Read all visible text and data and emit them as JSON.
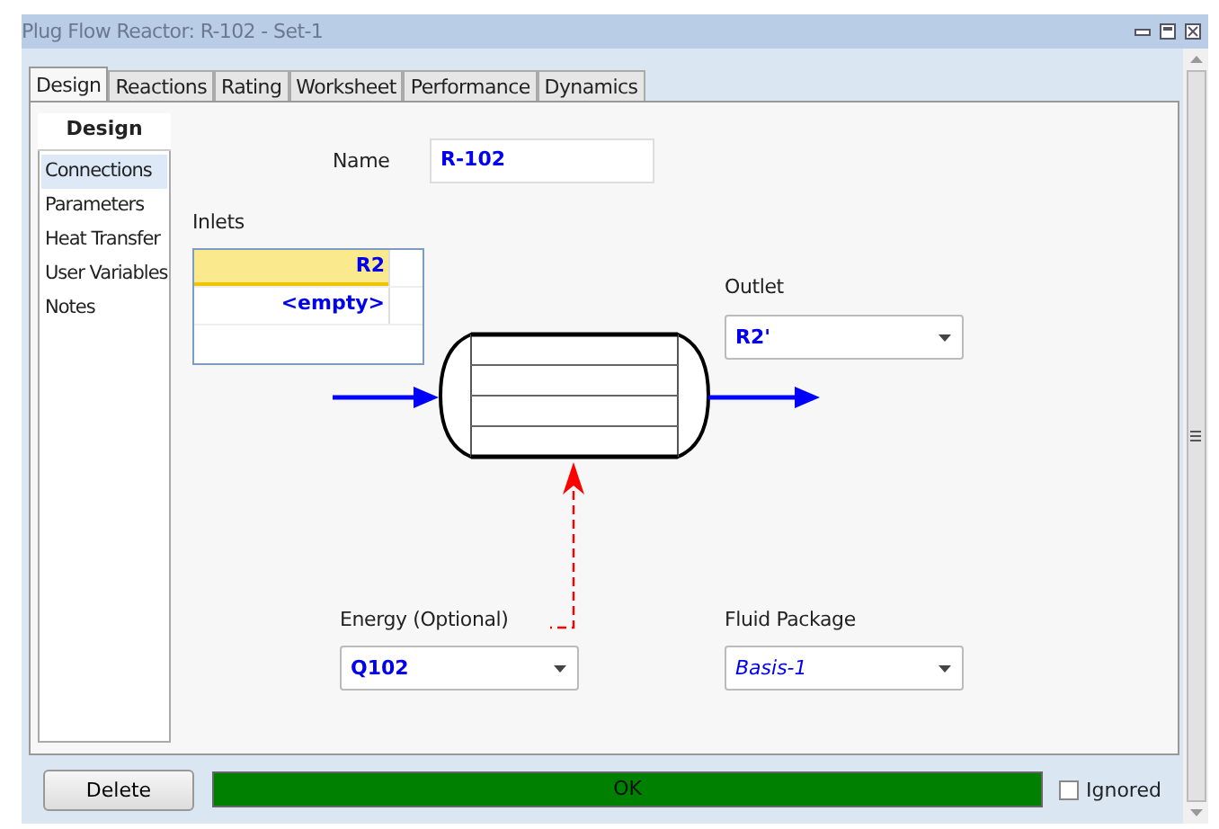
{
  "window": {
    "title": "Plug Flow Reactor: R-102 - Set-1"
  },
  "tabs": [
    {
      "label": "Design",
      "selected": true
    },
    {
      "label": "Reactions",
      "selected": false
    },
    {
      "label": "Rating",
      "selected": false
    },
    {
      "label": "Worksheet",
      "selected": false
    },
    {
      "label": "Performance",
      "selected": false
    },
    {
      "label": "Dynamics",
      "selected": false
    }
  ],
  "sidebar": {
    "header": "Design",
    "items": [
      {
        "label": "Connections",
        "selected": true
      },
      {
        "label": "Parameters",
        "selected": false
      },
      {
        "label": "Heat Transfer",
        "selected": false
      },
      {
        "label": "User Variables",
        "selected": false
      },
      {
        "label": "Notes",
        "selected": false
      }
    ]
  },
  "name": {
    "label": "Name",
    "value": "R-102"
  },
  "inlets": {
    "label": "Inlets",
    "rows": [
      {
        "value": "R2",
        "selected": true
      },
      {
        "value": "<empty>",
        "selected": false
      }
    ]
  },
  "outlet": {
    "label": "Outlet",
    "value": "R2'"
  },
  "energy": {
    "label": "Energy (Optional)",
    "value": "Q102"
  },
  "fluid_package": {
    "label": "Fluid Package",
    "value": "Basis-1"
  },
  "delete_button": "Delete",
  "status": "OK",
  "ignored": {
    "label": "Ignored",
    "checked": false
  }
}
